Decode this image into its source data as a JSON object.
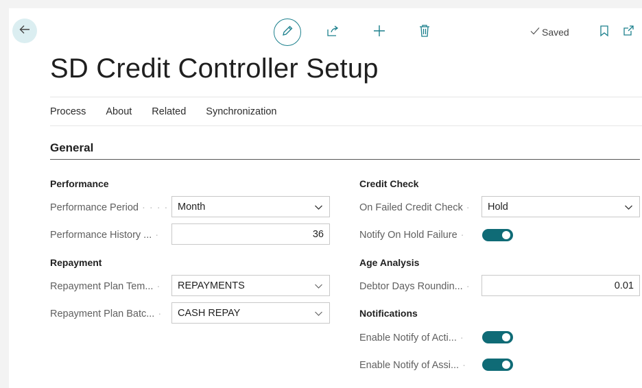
{
  "toolbar": {
    "saved_label": "Saved"
  },
  "page": {
    "title": "SD Credit Controller Setup"
  },
  "menu": {
    "items": [
      "Process",
      "About",
      "Related",
      "Synchronization"
    ]
  },
  "section": {
    "title": "General"
  },
  "performance": {
    "group_title": "Performance",
    "period_label": "Performance Period",
    "period_value": "Month",
    "history_label": "Performance History ...",
    "history_value": "36"
  },
  "repayment": {
    "group_title": "Repayment",
    "template_label": "Repayment Plan Tem...",
    "template_value": "REPAYMENTS",
    "batch_label": "Repayment Plan Batc...",
    "batch_value": "CASH REPAY"
  },
  "credit_check": {
    "group_title": "Credit Check",
    "failed_label": "On Failed Credit Check",
    "failed_value": "Hold",
    "notify_hold_label": "Notify On Hold Failure",
    "notify_hold_on": true
  },
  "age_analysis": {
    "group_title": "Age Analysis",
    "rounding_label": "Debtor Days Roundin...",
    "rounding_value": "0.01"
  },
  "notifications": {
    "group_title": "Notifications",
    "activity_label": "Enable Notify of Acti...",
    "activity_on": true,
    "assign_label": "Enable Notify of Assi...",
    "assign_on": true
  },
  "colors": {
    "accent": "#0f6b76",
    "back_button_bg": "#dbeef1"
  }
}
